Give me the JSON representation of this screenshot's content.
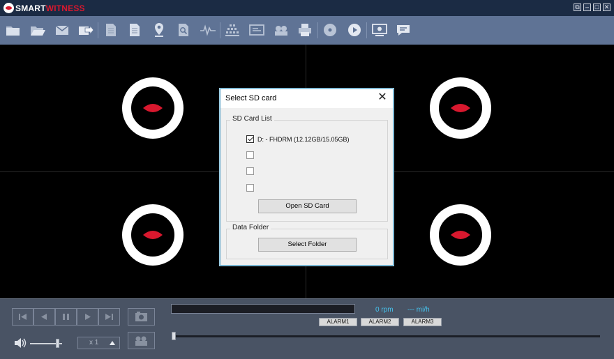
{
  "window": {
    "logo_part1": "SMART",
    "logo_part2": "WITNESS",
    "controls": [
      {
        "name": "restore-window-button",
        "glyph": "⧉"
      },
      {
        "name": "minimize-button",
        "glyph": "–"
      },
      {
        "name": "maximize-button",
        "glyph": "□"
      },
      {
        "name": "close-window-button",
        "glyph": "✕"
      }
    ]
  },
  "toolbar": {
    "icons": [
      "open-folder-icon",
      "open-file-icon",
      "email-icon",
      "export-icon",
      "document-icon",
      "report-icon",
      "map-pin-icon",
      "search-document-icon",
      "waveform-icon",
      "grid-icon",
      "screen-list-icon",
      "film-icon",
      "print-icon",
      "disc-icon",
      "play-circle-icon",
      "monitor-settings-icon",
      "chat-icon"
    ]
  },
  "dialog": {
    "title": "Select SD card",
    "close_glyph": "✕",
    "sd_group_label": "SD Card List",
    "cards": [
      {
        "label": "D: - FHDRM (12.12GB/15.05GB)",
        "checked": true
      },
      {
        "label": "",
        "checked": false
      },
      {
        "label": "",
        "checked": false
      },
      {
        "label": "",
        "checked": false
      }
    ],
    "open_button": "Open SD Card",
    "data_group_label": "Data Folder",
    "folder_button": "Select Folder"
  },
  "playback": {
    "speed": "x 1",
    "rpm": "0 rpm",
    "speed_reading": "--- mi/h",
    "alarms": [
      "ALARM1",
      "ALARM2",
      "ALARM3"
    ],
    "volume_level": 0.9,
    "seek_position": 0.0
  },
  "colors": {
    "brand_red": "#d8182e",
    "toolbar_bg": "#5f7395",
    "readout_blue": "#46c3ee"
  }
}
